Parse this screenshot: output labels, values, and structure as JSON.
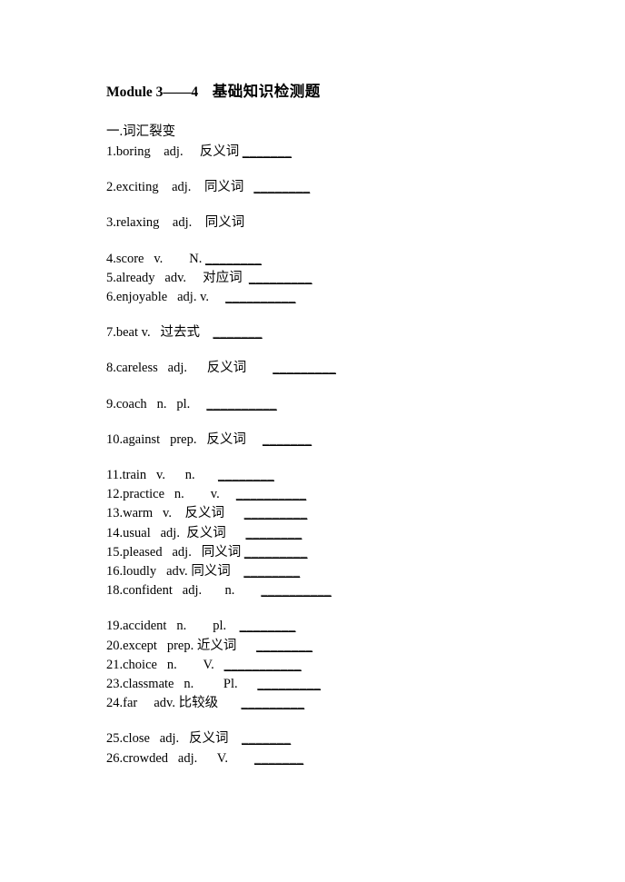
{
  "document": {
    "title_main": "Module 3——4",
    "title_spacer": "    ",
    "title_cn": "基础知识检测题",
    "section_heading": "一.词汇裂变"
  },
  "vocab": {
    "items": [
      {
        "num": "1.",
        "word": "boring",
        "sep1": "    ",
        "pos": "adj.",
        "sep2": "     ",
        "relation": "反义词",
        "sep3": " ",
        "blank": "_______",
        "gap": "none"
      },
      {
        "num": "2.",
        "word": "exciting",
        "sep1": "    ",
        "pos": "adj.",
        "sep2": "    ",
        "relation": "同义词",
        "sep3": "   ",
        "blank": "________",
        "gap": "md"
      },
      {
        "num": "3.",
        "word": "relaxing",
        "sep1": "    ",
        "pos": "adj.",
        "sep2": "    ",
        "relation": "同义词",
        "sep3": "",
        "blank": "",
        "gap": "md"
      },
      {
        "num": "4.",
        "word": "score",
        "sep1": "   ",
        "pos": "v.",
        "sep2": "        ",
        "relation": "N.",
        "sep3": " ",
        "blank": "________",
        "gap": "md"
      },
      {
        "num": "5.",
        "word": "already",
        "sep1": "   ",
        "pos": "adv.",
        "sep2": "     ",
        "relation": "对应词",
        "sep3": "  ",
        "blank": "_________",
        "gap": "none"
      },
      {
        "num": "6.",
        "word": "enjoyable",
        "sep1": "   ",
        "pos": "adj. v.",
        "sep2": "",
        "relation": "",
        "sep3": "     ",
        "blank": "__________",
        "gap": "none"
      },
      {
        "num": "7.",
        "word": "beat v.",
        "sep1": "   ",
        "pos": "",
        "sep2": "",
        "relation": "过去式",
        "sep3": "    ",
        "blank": "_______",
        "gap": "md"
      },
      {
        "num": "8.",
        "word": "careless",
        "sep1": "   ",
        "pos": "adj.",
        "sep2": "      ",
        "relation": "反义词",
        "sep3": "        ",
        "blank": "_________",
        "gap": "md"
      },
      {
        "num": "9.",
        "word": "coach",
        "sep1": "   ",
        "pos": "n.",
        "sep2": "   ",
        "relation": "pl.",
        "sep3": "     ",
        "blank": "__________",
        "gap": "md"
      },
      {
        "num": "10.",
        "word": "against",
        "sep1": "   ",
        "pos": "prep.",
        "sep2": "   ",
        "relation": "反义词",
        "sep3": "     ",
        "blank": "_______",
        "gap": "md"
      },
      {
        "num": "11.",
        "word": "train",
        "sep1": "   ",
        "pos": "v.",
        "sep2": "      ",
        "relation": "n.",
        "sep3": "       ",
        "blank": "________",
        "gap": "md"
      },
      {
        "num": "12.",
        "word": "practice",
        "sep1": "   ",
        "pos": "n.",
        "sep2": "        ",
        "relation": "v.",
        "sep3": "     ",
        "blank": "__________",
        "gap": "none"
      },
      {
        "num": "13.",
        "word": "warm",
        "sep1": "   ",
        "pos": "v.",
        "sep2": "    ",
        "relation": "反义词",
        "sep3": "      ",
        "blank": "_________",
        "gap": "none"
      },
      {
        "num": "14.",
        "word": "usual",
        "sep1": "   ",
        "pos": "adj.",
        "sep2": "  ",
        "relation": "反义词",
        "sep3": "      ",
        "blank": "________",
        "gap": "none"
      },
      {
        "num": "15.",
        "word": "pleased",
        "sep1": "   ",
        "pos": "adj.",
        "sep2": "   ",
        "relation": "同义词",
        "sep3": " ",
        "blank": "_________",
        "gap": "none"
      },
      {
        "num": "16.",
        "word": "loudly",
        "sep1": "   ",
        "pos": "adv.",
        "sep2": " ",
        "relation": "同义词",
        "sep3": "    ",
        "blank": "________",
        "gap": "none"
      },
      {
        "num": "18.",
        "word": "confident",
        "sep1": "   ",
        "pos": "adj.",
        "sep2": "       ",
        "relation": "n.",
        "sep3": "        ",
        "blank": "__________",
        "gap": "none"
      },
      {
        "num": "19.",
        "word": "accident",
        "sep1": "   ",
        "pos": "n.",
        "sep2": "        ",
        "relation": "pl.",
        "sep3": "    ",
        "blank": "________",
        "gap": "md"
      },
      {
        "num": "20.",
        "word": "except",
        "sep1": "   ",
        "pos": "prep.",
        "sep2": " ",
        "relation": "近义词",
        "sep3": "      ",
        "blank": "________",
        "gap": "none"
      },
      {
        "num": "21.",
        "word": "choice",
        "sep1": "   ",
        "pos": "n.",
        "sep2": "        ",
        "relation": "V.",
        "sep3": "   ",
        "blank": "___________",
        "gap": "none"
      },
      {
        "num": "23.",
        "word": "classmate",
        "sep1": "   ",
        "pos": "n.",
        "sep2": "         ",
        "relation": "Pl.",
        "sep3": "      ",
        "blank": "_________",
        "gap": "none"
      },
      {
        "num": "24.",
        "word": "far",
        "sep1": "     ",
        "pos": "adv.",
        "sep2": " ",
        "relation": "比较级",
        "sep3": "       ",
        "blank": "_________",
        "gap": "none"
      },
      {
        "num": "25.",
        "word": "close",
        "sep1": "   ",
        "pos": "adj.",
        "sep2": "   ",
        "relation": "反义词",
        "sep3": "    ",
        "blank": "_______",
        "gap": "md"
      },
      {
        "num": "26.",
        "word": "crowded",
        "sep1": "   ",
        "pos": "adj.",
        "sep2": "      ",
        "relation": "V.",
        "sep3": "        ",
        "blank": "_______",
        "gap": "none"
      }
    ]
  }
}
